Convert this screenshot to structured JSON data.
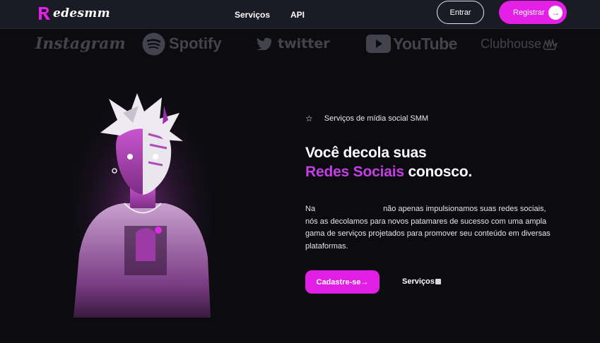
{
  "nav": {
    "logo_text": "edesmm",
    "links": [
      "Serviços",
      "API"
    ],
    "login_label": "Entrar",
    "register_label": "Registrar",
    "register_icon": "arrow-right-icon"
  },
  "brands": [
    "Instagram",
    "Spotify",
    "twitter",
    "YouTube",
    "Clubhouse"
  ],
  "hero": {
    "tagline": "Serviços de mídia social SMM",
    "tagline_icon": "star-outline-icon",
    "headline_line1": "Você decola suas",
    "headline_accent": "Redes Sociais",
    "headline_rest": " conosco.",
    "description_start": "Na",
    "description_rest": "não apenas impulsionamos suas redes sociais, nós as decolamos para novos patamares de sucesso com uma ampla gama de serviços projetados para promover seu conteúdo em diversas plataformas.",
    "cta_label": "Cadastre-se",
    "cta_icon": "→",
    "secondary_label": "Serviços"
  },
  "colors": {
    "accent": "#e520e6",
    "headline_accent": "#c53ee6",
    "background": "#0c0c10",
    "nav_bg": "#1a1b24"
  }
}
